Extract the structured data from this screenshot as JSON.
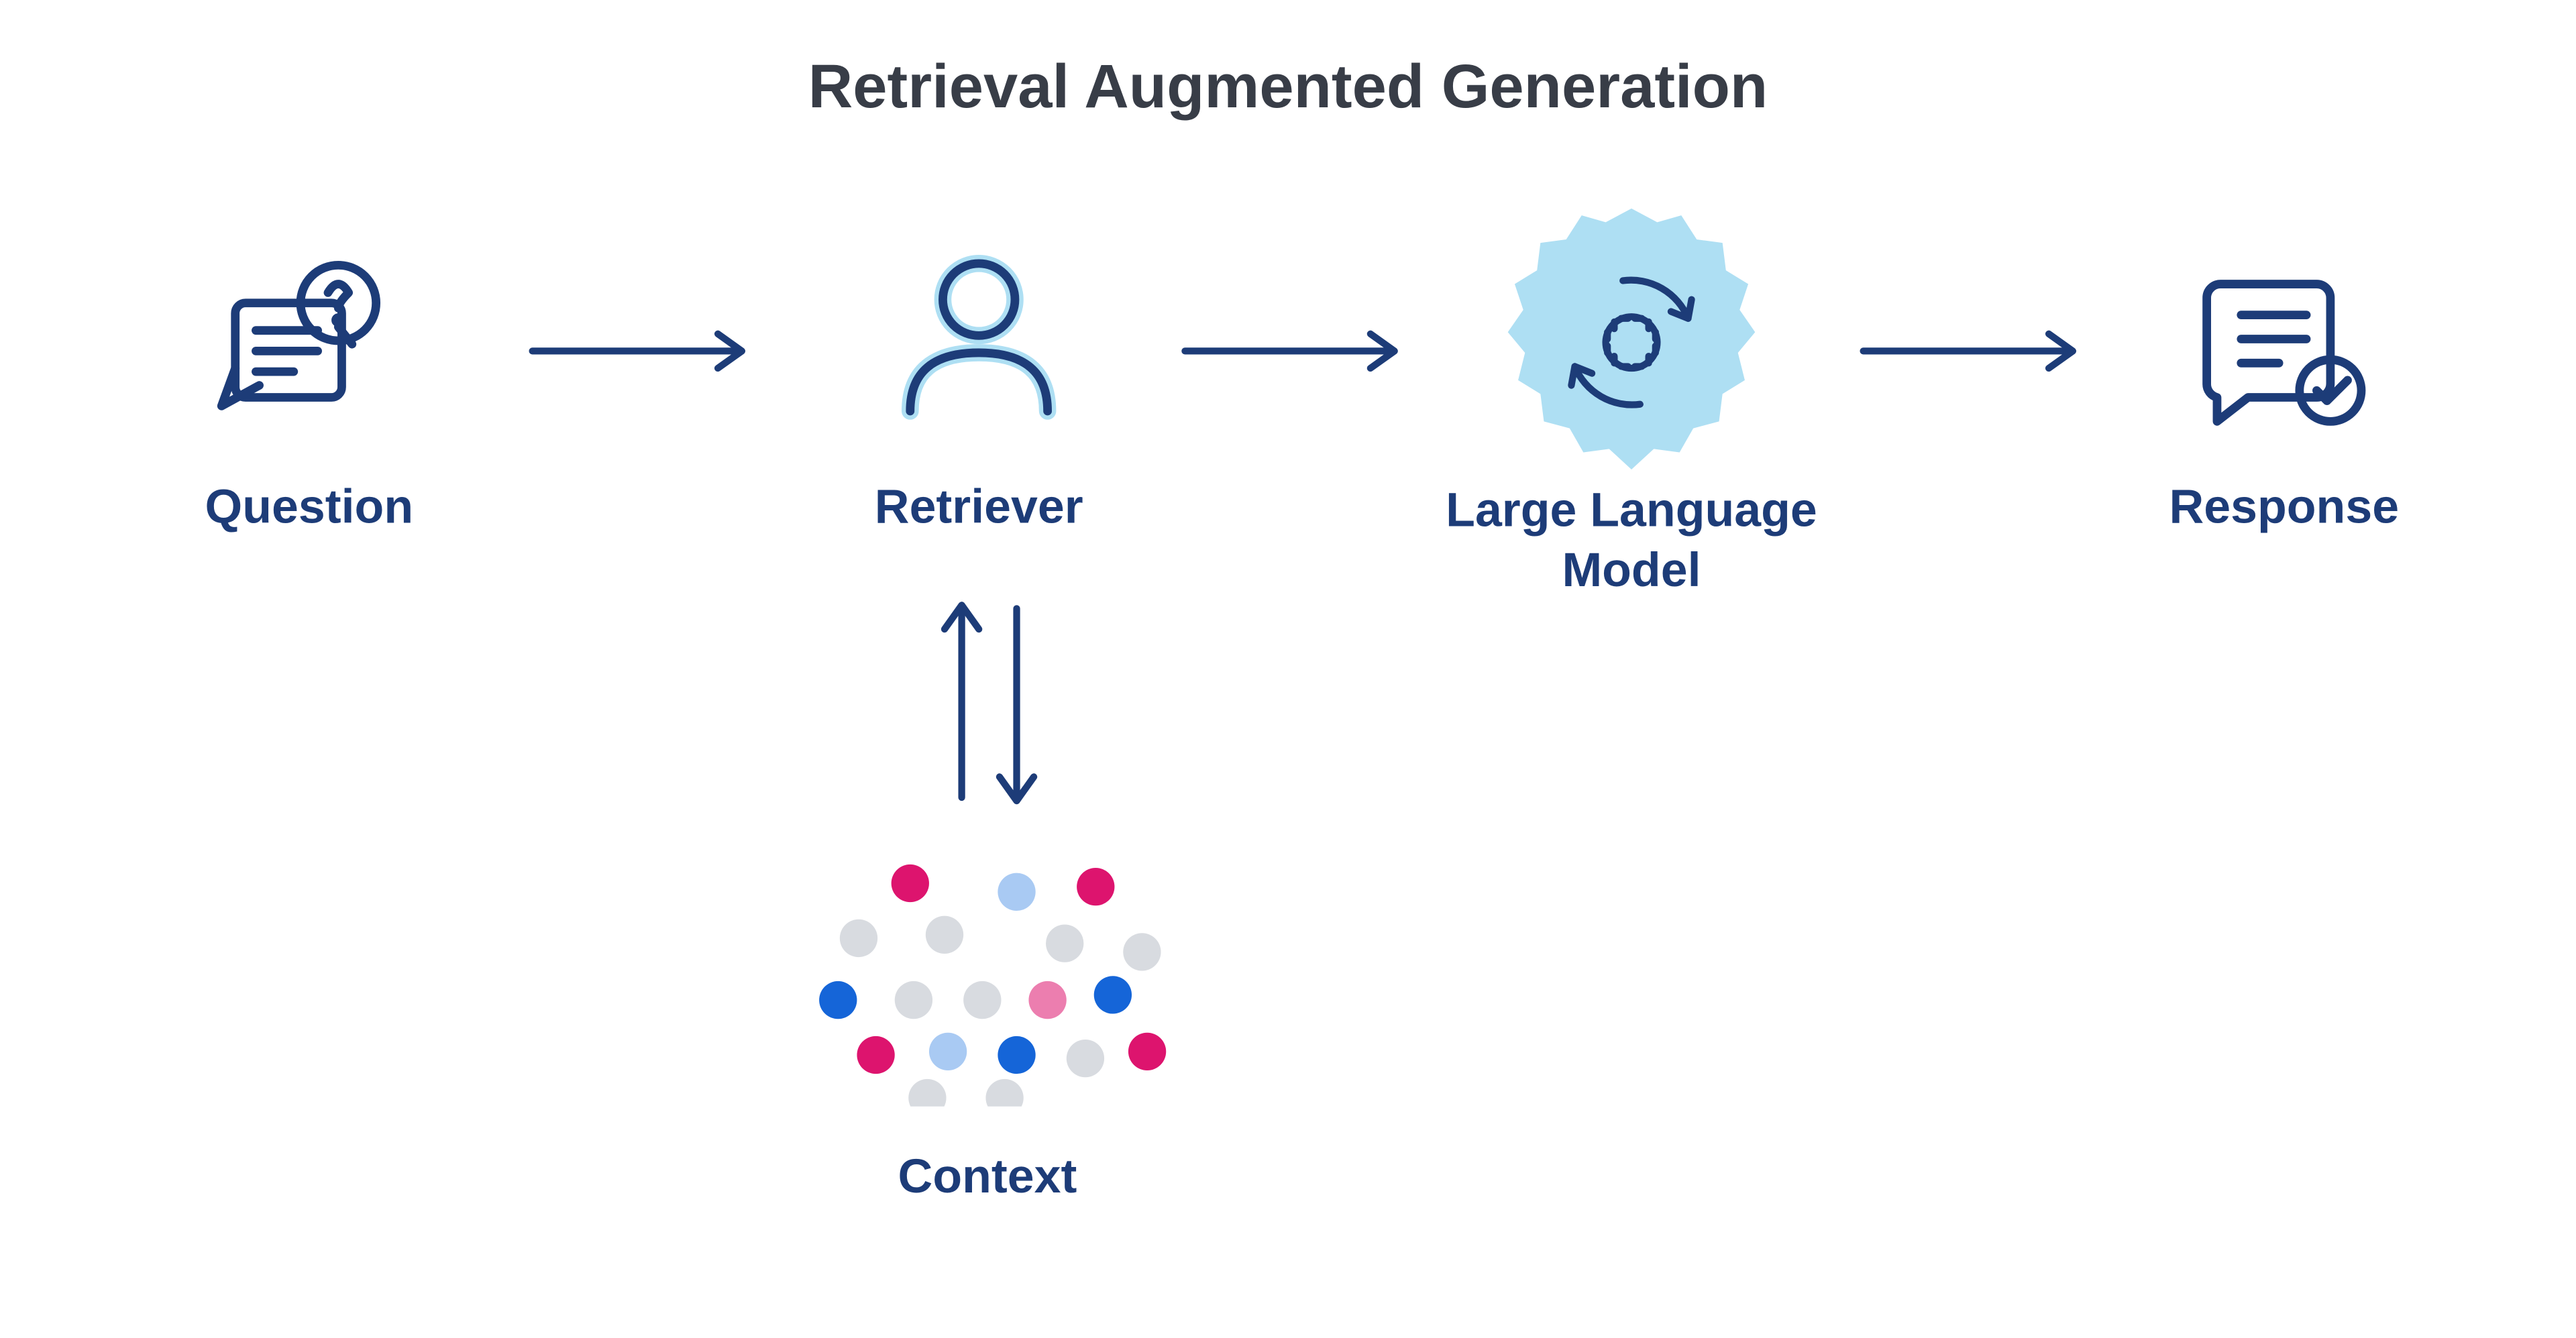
{
  "title": "Retrieval Augmented Generation",
  "nodes": {
    "question": {
      "label": "Question"
    },
    "retriever": {
      "label": "Retriever"
    },
    "llm": {
      "label": "Large Language\nModel"
    },
    "response": {
      "label": "Response"
    },
    "context": {
      "label": "Context"
    }
  },
  "flow": [
    [
      "question",
      "retriever"
    ],
    [
      "retriever",
      "llm"
    ],
    [
      "llm",
      "response"
    ],
    [
      "retriever",
      "context",
      "bidirectional"
    ]
  ],
  "colors": {
    "stroke": "#1d3c78",
    "title": "#383d47",
    "gear_bg": "#aedff3",
    "dot_pink": "#dd146e",
    "dot_blue": "#1565d8",
    "dot_lblue": "#a9caf3",
    "dot_grey": "#d8dbe0"
  }
}
